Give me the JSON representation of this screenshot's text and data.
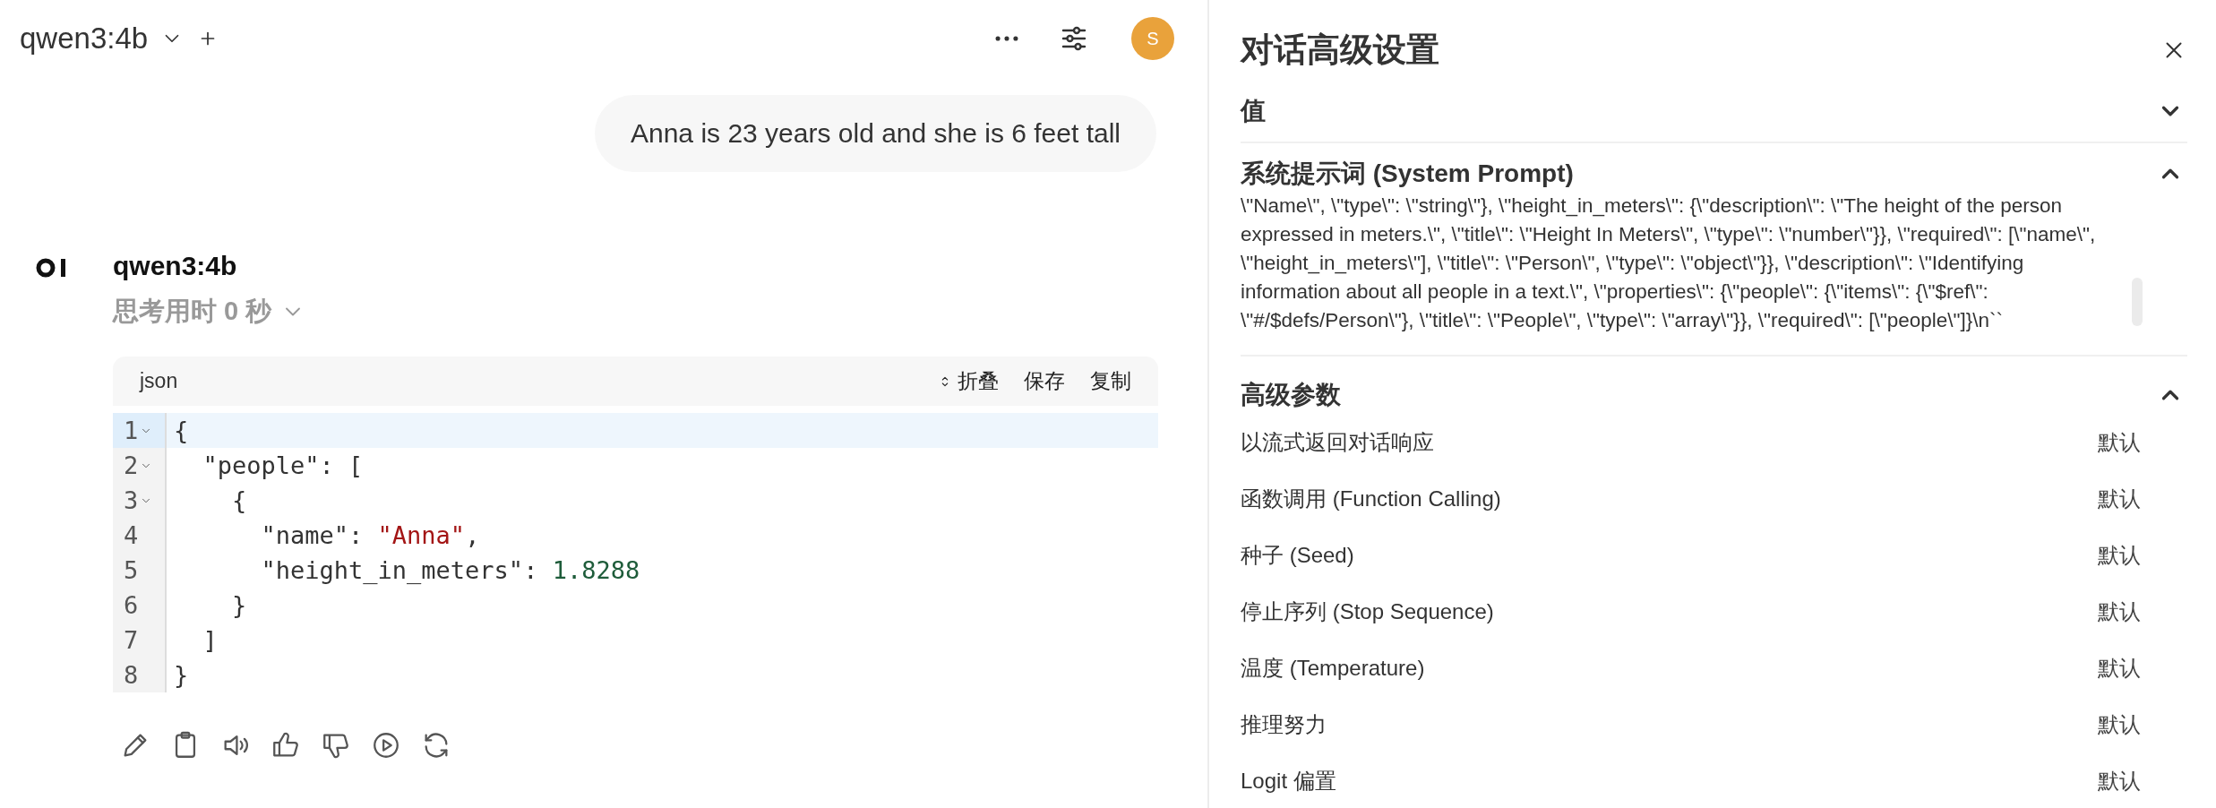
{
  "chat": {
    "header": {
      "model": "qwen3:4b",
      "avatar": "S"
    },
    "user_message": "Anna is 23 years old and she is 6 feet tall",
    "assistant": {
      "name": "qwen3:4b",
      "thinking": "思考用时 0 秒",
      "thinking_expanded": false
    },
    "code_block": {
      "language": "json",
      "actions": [
        "折叠",
        "保存",
        "复制"
      ],
      "lines": [
        {
          "number": "1",
          "foldable": true,
          "active": true,
          "tokens": [
            {
              "kind": "punct",
              "text": "{"
            }
          ]
        },
        {
          "number": "2",
          "foldable": true,
          "active": false,
          "tokens": [
            {
              "kind": "punct",
              "text": "  \"people\": ["
            }
          ]
        },
        {
          "number": "3",
          "foldable": true,
          "active": false,
          "tokens": [
            {
              "kind": "punct",
              "text": "    {"
            }
          ]
        },
        {
          "number": "4",
          "foldable": false,
          "active": false,
          "tokens": [
            {
              "kind": "punct",
              "text": "      \"name\": "
            },
            {
              "kind": "string",
              "text": "\"Anna\""
            },
            {
              "kind": "punct",
              "text": ","
            }
          ]
        },
        {
          "number": "5",
          "foldable": false,
          "active": false,
          "tokens": [
            {
              "kind": "punct",
              "text": "      \"height_in_meters\": "
            },
            {
              "kind": "number",
              "text": "1.8288"
            }
          ]
        },
        {
          "number": "6",
          "foldable": false,
          "active": false,
          "tokens": [
            {
              "kind": "punct",
              "text": "    }"
            }
          ]
        },
        {
          "number": "7",
          "foldable": false,
          "active": false,
          "tokens": [
            {
              "kind": "punct",
              "text": "  ]"
            }
          ]
        },
        {
          "number": "8",
          "foldable": false,
          "active": false,
          "tokens": [
            {
              "kind": "punct",
              "text": "}"
            }
          ]
        }
      ]
    }
  },
  "settings": {
    "title": "对话高级设置",
    "sections": [
      {
        "title": "值",
        "expanded": false
      },
      {
        "title": "系统提示词 (System Prompt)",
        "expanded": true,
        "text": "\\\"Name\\\", \\\"type\\\": \\\"string\\\"}, \\\"height_in_meters\\\": {\\\"description\\\": \\\"The height of the person expressed in meters.\\\", \\\"title\\\": \\\"Height In Meters\\\", \\\"type\\\": \\\"number\\\"}}, \\\"required\\\": [\\\"name\\\", \\\"height_in_meters\\\"], \\\"title\\\": \\\"Person\\\", \\\"type\\\": \\\"object\\\"}}, \\\"description\\\": \\\"Identifying information about all people in a text.\\\", \\\"properties\\\": {\\\"people\\\": {\\\"items\\\": {\\\"$ref\\\": \\\"#/$defs/Person\\\"}, \\\"title\\\": \\\"People\\\", \\\"type\\\": \\\"array\\\"}}, \\\"required\\\": [\\\"people\\\"]}\\n``"
      },
      {
        "title": "高级参数",
        "expanded": true,
        "params": [
          {
            "label": "以流式返回对话响应",
            "value": "默认"
          },
          {
            "label": "函数调用 (Function Calling)",
            "value": "默认"
          },
          {
            "label": "种子 (Seed)",
            "value": "默认"
          },
          {
            "label": "停止序列 (Stop Sequence)",
            "value": "默认"
          },
          {
            "label": "温度 (Temperature)",
            "value": "默认"
          },
          {
            "label": "推理努力",
            "value": "默认"
          },
          {
            "label": "Logit 偏置",
            "value": "默认"
          }
        ]
      }
    ]
  }
}
